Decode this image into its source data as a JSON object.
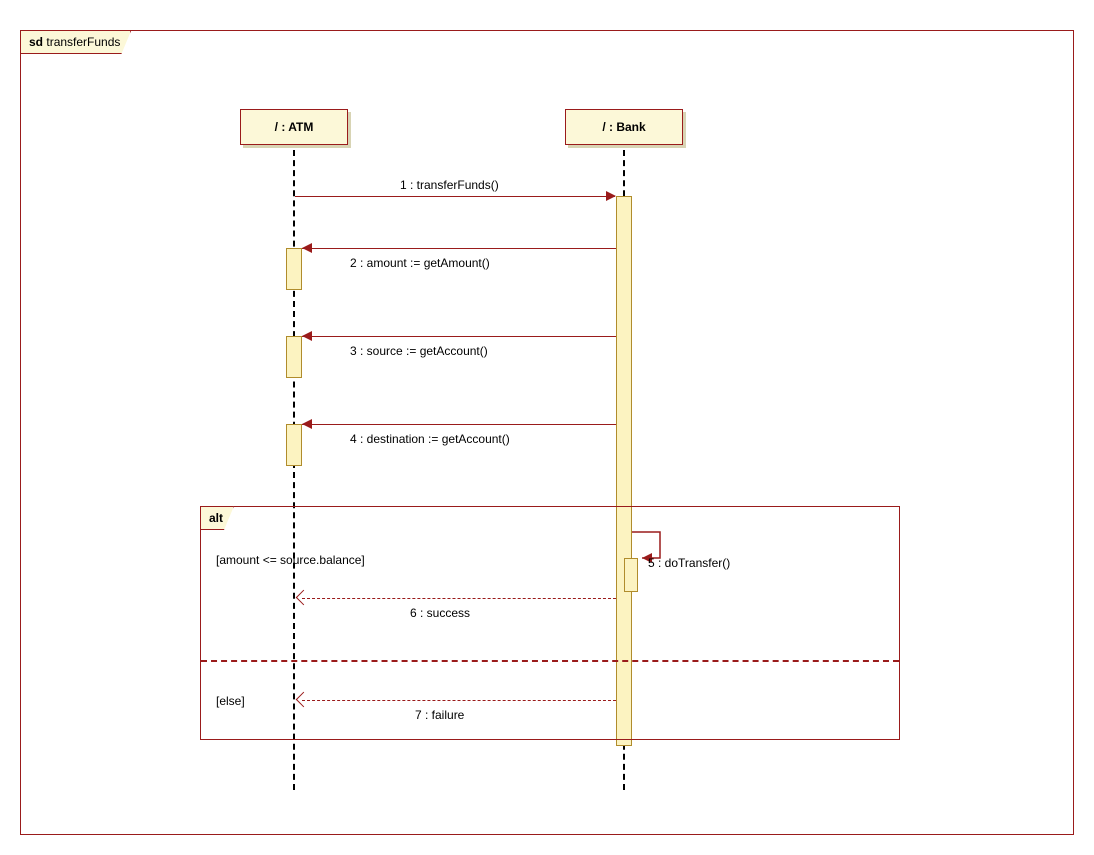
{
  "diagram": {
    "frame_keyword": "sd",
    "frame_name": "transferFunds",
    "lifelines": {
      "atm": "/ : ATM",
      "bank": "/ : Bank"
    },
    "messages": {
      "m1": "1 : transferFunds()",
      "m2": "2 : amount := getAmount()",
      "m3": "3 : source := getAccount()",
      "m4": "4 : destination := getAccount()",
      "m5": "5 : doTransfer()",
      "m6": "6 : success",
      "m7": "7 : failure"
    },
    "alt": {
      "keyword": "alt",
      "guard1": "[amount <= source.balance]",
      "guard2": "[else]"
    }
  }
}
